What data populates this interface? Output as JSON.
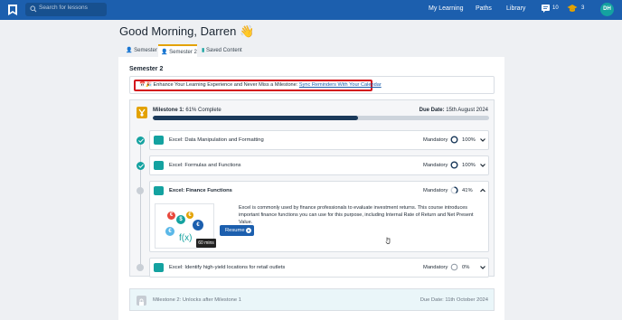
{
  "header": {
    "search_placeholder": "Search for lessons",
    "nav": [
      "My Learning",
      "Paths",
      "Library"
    ],
    "messages_count": "10",
    "achievements_count": "3",
    "avatar_initials": "DH",
    "brand_color": "#1c5fae"
  },
  "greeting": "Good Morning, Darren 👋",
  "tabs": [
    {
      "label": "Semester 1"
    },
    {
      "label": "Semester 2",
      "active": true
    },
    {
      "label": "Saved Content"
    }
  ],
  "semester_title": "Semester 2",
  "banner": {
    "emoji": "📅🎉",
    "text": "Enhance Your Learning Experience and Never Miss a Milestone: ",
    "link": "Sync Reminders With Your Calendar"
  },
  "milestone1": {
    "label_bold": "Milestone 1:",
    "label_rest": " 61% Complete",
    "progress": 0.61,
    "due_label": "Due Date:",
    "due_value": " 15th August 2024"
  },
  "lessons": [
    {
      "title": "Excel: Data Manipulation and Formatting",
      "mandatory": "Mandatory",
      "percent": "100%",
      "completed": true
    },
    {
      "title": "Excel: Formulas and Functions",
      "mandatory": "Mandatory",
      "percent": "100%",
      "completed": true
    },
    {
      "title": "Excel: Finance Functions",
      "mandatory": "Mandatory",
      "percent": "41%",
      "completed": false,
      "expanded": true,
      "description": "Excel is commonly used by finance professionals to evaluate investment returns. This course introduces important finance functions you can use for this purpose, including Internal Rate of Return and Net Present Value.",
      "thumbnail_text": "f(x)",
      "duration": "60 mins",
      "resume_label": "Resume"
    },
    {
      "title": "Excel: Identify high-yield locations for retail outlets",
      "mandatory": "Mandatory",
      "percent": "0%",
      "completed": false
    }
  ],
  "milestone2": {
    "label": "Milestone 2: Unlocks after Milestone 1",
    "due_label": "Due Date:",
    "due_value": " 11th October 2024"
  },
  "colors": {
    "teal": "#14a2a0",
    "milestone_accent": "#e3a200",
    "banner_border": "#d3141c",
    "progress_fill": "#1b3a5b"
  }
}
